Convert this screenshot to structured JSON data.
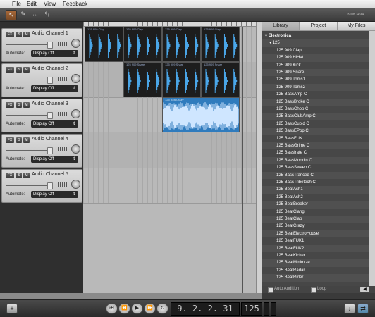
{
  "menu": [
    "File",
    "Edit",
    "View",
    "Feedback"
  ],
  "toolbar": {
    "build_label": "Build 3494"
  },
  "tracks": [
    {
      "name": "Audio Channel 1",
      "fx": "FX",
      "s": "S",
      "m": "M",
      "automate_label": "Automate:",
      "automate_value": "Display Off"
    },
    {
      "name": "Audio Channel 2",
      "fx": "FX",
      "s": "S",
      "m": "M",
      "automate_label": "Automate:",
      "automate_value": "Display Off"
    },
    {
      "name": "Audio Channel 3",
      "fx": "FX",
      "s": "S",
      "m": "M",
      "automate_label": "Automate:",
      "automate_value": "Display Off"
    },
    {
      "name": "Audio Channel 4",
      "fx": "FX",
      "s": "S",
      "m": "M",
      "automate_label": "Automate:",
      "automate_value": "Display Off"
    },
    {
      "name": "Audio Channel 5",
      "fx": "FX",
      "s": "S",
      "m": "M",
      "automate_label": "Automate:",
      "automate_value": "Display Off"
    }
  ],
  "regions": {
    "clap": "125 909 Clap",
    "snare": "125 909 Snare",
    "long": "125 BeatCrazy"
  },
  "library": {
    "tabs": [
      "Library",
      "Project",
      "My Files"
    ],
    "folder": "Electronica",
    "subfolder": "125",
    "items": [
      "125 909 Clap",
      "125 909 HiHat",
      "125 909 Kick",
      "125 909 Snare",
      "125 909 Toms1",
      "125 909 Toms2",
      "125 BassAmp C",
      "125 BassBroke C",
      "125 BassChop C",
      "125 BassClubAmp C",
      "125 BassCupid C",
      "125 BassEPop C",
      "125 BassFUK",
      "125 BassGrime C",
      "125 BassIrate C",
      "125 BassMoodin C",
      "125 BassSweep C",
      "125 BassTranced C",
      "125 BassTribetech C",
      "125 BeatAsh1",
      "125 BeatAsh2",
      "125 BeatBreaker",
      "125 BeatClang",
      "125 BeatClap",
      "125 BeatCrazy",
      "125 BeatElectroHouse",
      "125 BeatFUK1",
      "125 BeatFUK2",
      "125 BeatKicker",
      "125 BeatMinimize",
      "125 BeatRadar",
      "125 BeatRider"
    ],
    "auto_audition": "Auto Audition",
    "loop": "Loop"
  },
  "transport": {
    "position": "9. 2. 2.  31",
    "tempo": "125"
  }
}
